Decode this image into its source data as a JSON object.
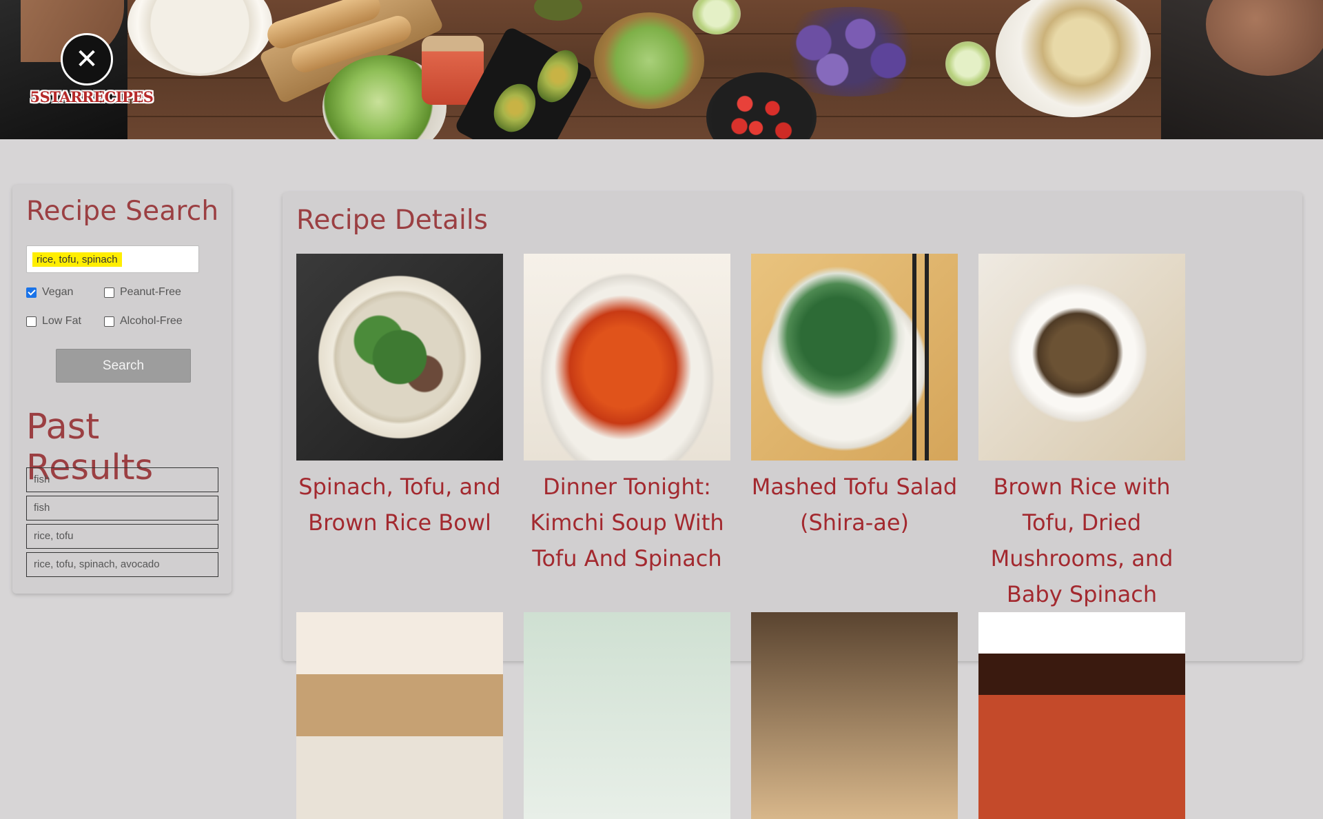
{
  "header": {
    "logo_text": "5STARRECIPES",
    "logo_icon": "fork-knife-icon"
  },
  "sidebar": {
    "search_title": "Recipe Search",
    "search_value": "rice, tofu, spinach",
    "filters": [
      {
        "label": "Vegan",
        "checked": true
      },
      {
        "label": "Peanut-Free",
        "checked": false
      },
      {
        "label": "Low Fat",
        "checked": false
      },
      {
        "label": "Alcohol-Free",
        "checked": false
      }
    ],
    "search_button": "Search",
    "past_title": "Past Results",
    "past_results": [
      "fish",
      "fish",
      "rice, tofu",
      "rice, tofu, spinach, avocado"
    ]
  },
  "main": {
    "title": "Recipe Details",
    "recipes": [
      {
        "title": "Spinach, Tofu, and Brown Rice Bowl"
      },
      {
        "title": "Dinner Tonight: Kimchi Soup With Tofu And Spinach"
      },
      {
        "title": "Mashed Tofu Salad (Shira-ae)"
      },
      {
        "title": "Brown Rice with Tofu, Dried Mushrooms, and Baby Spinach"
      }
    ]
  },
  "colors": {
    "accent": "#9b3f42",
    "card_title": "#a3292f",
    "background": "#d7d5d6",
    "highlight": "#ffee00"
  }
}
